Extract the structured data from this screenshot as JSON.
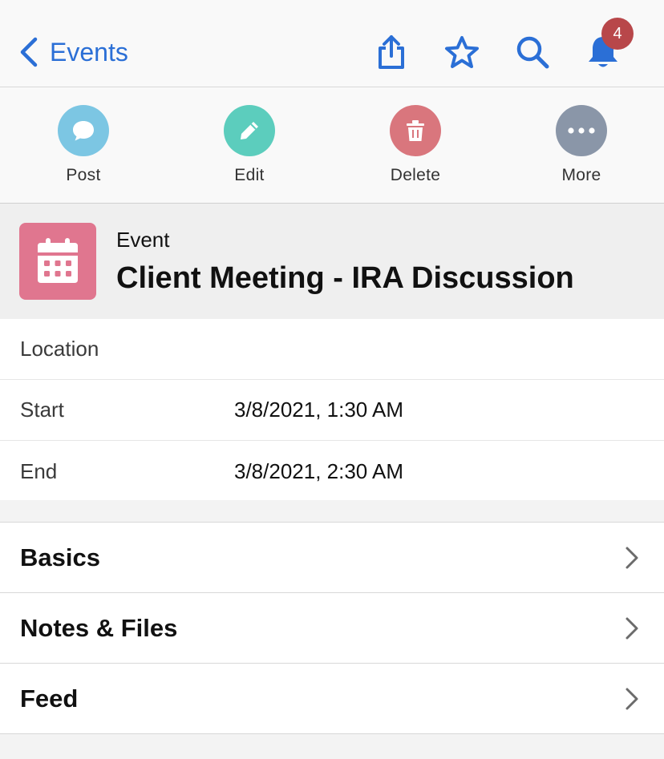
{
  "nav": {
    "back_label": "Events",
    "notification_count": "4",
    "accent": "#2b6fd6"
  },
  "actions": [
    {
      "label": "Post",
      "icon": "chat-bubble-icon",
      "color": "#7cc6e3"
    },
    {
      "label": "Edit",
      "icon": "pencil-icon",
      "color": "#5ccdbd"
    },
    {
      "label": "Delete",
      "icon": "trash-icon",
      "color": "#d9767d"
    },
    {
      "label": "More",
      "icon": "ellipsis-icon",
      "color": "#8a96a8"
    }
  ],
  "record": {
    "object_type": "Event",
    "title": "Client Meeting - IRA Discussion",
    "icon": "calendar-icon",
    "icon_color": "#e0768f"
  },
  "details": [
    {
      "label": "Location",
      "value": ""
    },
    {
      "label": "Start",
      "value": "3/8/2021, 1:30 AM"
    },
    {
      "label": "End",
      "value": "3/8/2021, 2:30 AM"
    }
  ],
  "sections": [
    {
      "title": "Basics"
    },
    {
      "title": "Notes & Files"
    },
    {
      "title": "Feed"
    }
  ]
}
